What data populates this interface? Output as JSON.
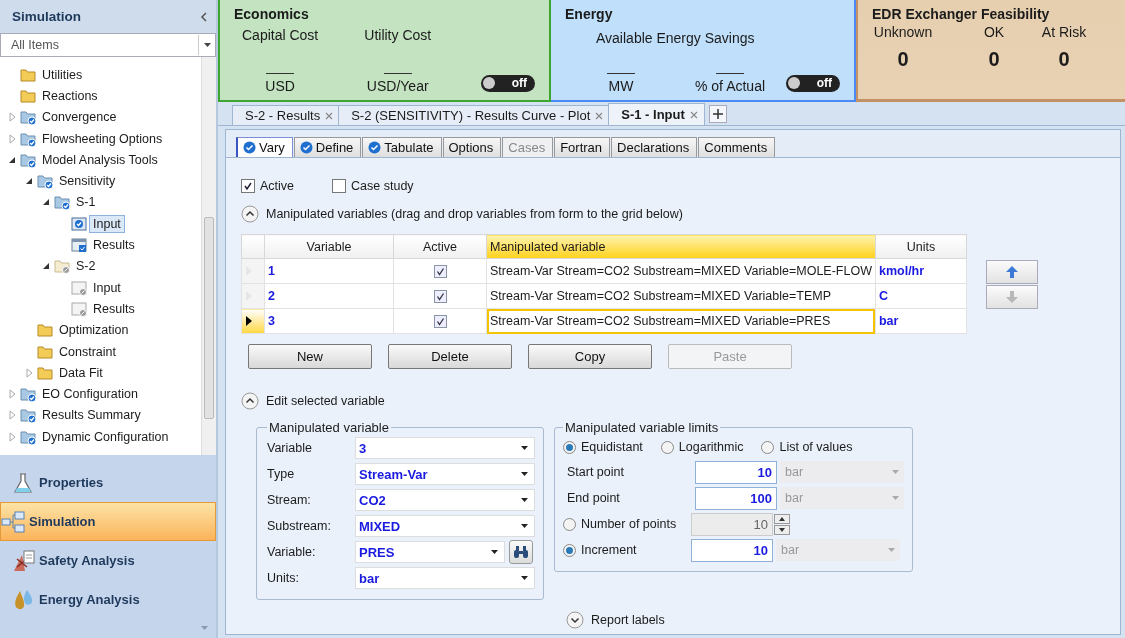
{
  "sidebar": {
    "title": "Simulation",
    "filter": "All Items",
    "tree": [
      {
        "label": "Utilities",
        "kind": "folder",
        "selected": false
      },
      {
        "label": "Reactions",
        "kind": "folder",
        "selected": false
      },
      {
        "label": "Convergence",
        "kind": "done",
        "expanded": false,
        "selected": false
      },
      {
        "label": "Flowsheeting Options",
        "kind": "done",
        "expanded": false,
        "selected": false
      },
      {
        "label": "Model Analysis Tools",
        "kind": "done",
        "expanded": true,
        "selected": false,
        "children": [
          {
            "label": "Sensitivity",
            "kind": "done",
            "expanded": true,
            "selected": false,
            "children": [
              {
                "label": "S-1",
                "kind": "done",
                "expanded": true,
                "selected": false,
                "children": [
                  {
                    "label": "Input",
                    "kind": "form",
                    "selected": true
                  },
                  {
                    "label": "Results",
                    "kind": "results",
                    "selected": false
                  }
                ]
              },
              {
                "label": "S-2",
                "kind": "inactive",
                "expanded": true,
                "selected": false,
                "children": [
                  {
                    "label": "Input",
                    "kind": "page",
                    "selected": false
                  },
                  {
                    "label": "Results",
                    "kind": "page",
                    "selected": false
                  }
                ]
              }
            ]
          },
          {
            "label": "Optimization",
            "kind": "folder",
            "selected": false
          },
          {
            "label": "Constraint",
            "kind": "folder",
            "selected": false
          },
          {
            "label": "Data Fit",
            "kind": "folder",
            "expanded": false,
            "selected": false
          }
        ]
      },
      {
        "label": "EO Configuration",
        "kind": "done",
        "expanded": false,
        "selected": false
      },
      {
        "label": "Results Summary",
        "kind": "done",
        "expanded": false,
        "selected": false
      },
      {
        "label": "Dynamic Configuration",
        "kind": "done",
        "expanded": false,
        "selected": false
      }
    ],
    "nav": [
      {
        "label": "Properties",
        "kind": "flask",
        "selected": false
      },
      {
        "label": "Simulation",
        "kind": "flowsheet",
        "selected": true
      },
      {
        "label": "Safety Analysis",
        "kind": "safety",
        "selected": false
      },
      {
        "label": "Energy Analysis",
        "kind": "energy",
        "selected": false
      }
    ]
  },
  "banner": {
    "economics": {
      "title": "Economics",
      "metrics": [
        {
          "label": "Capital Cost",
          "unit": "USD"
        },
        {
          "label": "Utility Cost",
          "unit": "USD/Year"
        }
      ],
      "toggle": {
        "label": "off",
        "on": false
      }
    },
    "energy": {
      "title": "Energy",
      "metric_label": "Available Energy Savings",
      "units": [
        "MW",
        "% of Actual"
      ],
      "toggle": {
        "label": "off",
        "on": false
      }
    },
    "edr": {
      "title": "EDR Exchanger Feasibility",
      "counts": [
        {
          "label": "Unknown",
          "value": "0"
        },
        {
          "label": "OK",
          "value": "0"
        },
        {
          "label": "At Risk",
          "value": "0"
        }
      ]
    }
  },
  "document_tabs": [
    {
      "label": "S-2 - Results",
      "selected": false
    },
    {
      "label": "S-2 (SENSITIVITY) - Results Curve - Plot",
      "selected": false
    },
    {
      "label": "S-1 - Input",
      "selected": true
    }
  ],
  "form_tabs": [
    {
      "label": "Vary",
      "complete": true,
      "selected": true,
      "disabled": false
    },
    {
      "label": "Define",
      "complete": true,
      "selected": false,
      "disabled": false
    },
    {
      "label": "Tabulate",
      "complete": true,
      "selected": false,
      "disabled": false
    },
    {
      "label": "Options",
      "complete": false,
      "selected": false,
      "disabled": false
    },
    {
      "label": "Cases",
      "complete": false,
      "selected": false,
      "disabled": true
    },
    {
      "label": "Fortran",
      "complete": false,
      "selected": false,
      "disabled": false
    },
    {
      "label": "Declarations",
      "complete": false,
      "selected": false,
      "disabled": false
    },
    {
      "label": "Comments",
      "complete": false,
      "selected": false,
      "disabled": false
    }
  ],
  "options": [
    {
      "label": "Active",
      "checked": true
    },
    {
      "label": "Case study",
      "checked": false
    }
  ],
  "variables_section": {
    "title": "Manipulated variables (drag and drop variables from form to the grid below)",
    "expanded": true
  },
  "grid": {
    "columns": [
      {
        "label": "Variable",
        "current": false
      },
      {
        "label": "Active",
        "current": false
      },
      {
        "label": "Manipulated variable",
        "current": true
      },
      {
        "label": "Units",
        "current": false
      }
    ],
    "rows": [
      {
        "variable": "1",
        "active": true,
        "manipulated": "Stream-Var Stream=CO2 Substream=MIXED Variable=MOLE-FLOW",
        "units": "kmol/hr",
        "selected": false
      },
      {
        "variable": "2",
        "active": true,
        "manipulated": "Stream-Var Stream=CO2 Substream=MIXED Variable=TEMP",
        "units": "C",
        "selected": false
      },
      {
        "variable": "3",
        "active": true,
        "manipulated": "Stream-Var Stream=CO2 Substream=MIXED Variable=PRES",
        "units": "bar",
        "selected": true
      }
    ]
  },
  "move_buttons": [
    {
      "kind": "up",
      "disabled": false
    },
    {
      "kind": "down",
      "disabled": true
    }
  ],
  "grid_buttons": [
    {
      "label": "New",
      "disabled": false
    },
    {
      "label": "Delete",
      "disabled": false
    },
    {
      "label": "Copy",
      "disabled": false
    },
    {
      "label": "Paste",
      "disabled": true
    }
  ],
  "edit_section": {
    "title": "Edit selected variable",
    "expanded": true
  },
  "variable_group": {
    "title": "Manipulated variable",
    "fields": [
      {
        "kind": "select",
        "label": "Variable",
        "value": "3"
      },
      {
        "kind": "select",
        "label": "Type",
        "value": "Stream-Var"
      },
      {
        "kind": "select",
        "label": "Stream:",
        "value": "CO2"
      },
      {
        "kind": "select",
        "label": "Substream:",
        "value": "MIXED"
      },
      {
        "kind": "search",
        "label": "Variable:",
        "value": "PRES"
      },
      {
        "kind": "select",
        "label": "Units:",
        "value": "bar"
      }
    ]
  },
  "limits_group": {
    "title": "Manipulated variable limits",
    "modes": [
      {
        "label": "Equidistant",
        "selected": true
      },
      {
        "label": "Logarithmic",
        "selected": false
      },
      {
        "label": "List of values",
        "selected": false
      }
    ],
    "rows": [
      {
        "kind": "value",
        "label": "Start point",
        "value": "10",
        "unit": "bar"
      },
      {
        "kind": "value",
        "label": "End point",
        "value": "100",
        "unit": "bar"
      },
      {
        "kind": "count",
        "label": "Number of points",
        "selected": false,
        "value": "10"
      },
      {
        "kind": "step",
        "label": "Increment",
        "selected": true,
        "value": "10",
        "unit": "bar"
      }
    ]
  },
  "report_section": {
    "title": "Report labels",
    "expanded": false
  }
}
